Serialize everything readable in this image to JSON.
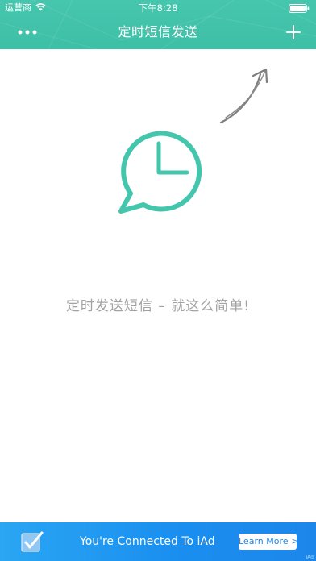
{
  "status_bar": {
    "carrier": "运营商",
    "time": "下午8:28",
    "wifi_icon": "wifi-icon",
    "battery_icon": "battery-icon"
  },
  "nav": {
    "title": "定时短信发送",
    "more_icon": "more-dots-icon",
    "add_icon": "plus-icon"
  },
  "main": {
    "hint_icon": "curved-arrow-icon",
    "clock_icon": "clock-speech-bubble-icon",
    "empty_message": "定时发送短信 – 就这么简单!"
  },
  "ad": {
    "text": "You're Connected To iAd",
    "button_label": "Learn More",
    "button_chevron": ">",
    "mark": "iAd",
    "check_icon": "checkbox-icon"
  },
  "colors": {
    "header": "#3fc2a9",
    "accent": "#44c6ad",
    "ad_background": "#1a8ff0",
    "text_muted": "#a3a3a3"
  }
}
